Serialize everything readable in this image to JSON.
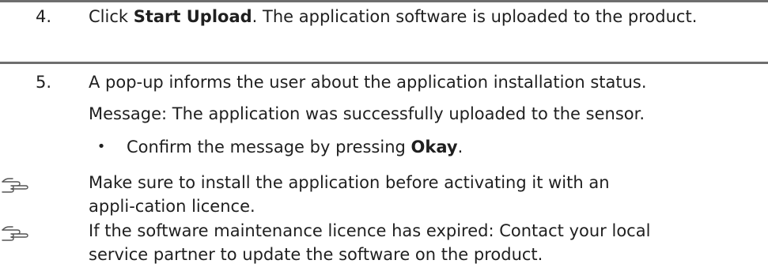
{
  "steps": [
    {
      "number": "4.",
      "text_before": "Click ",
      "bold": "Start Upload",
      "text_after": ". The application software is uploaded to the product."
    },
    {
      "number": "5.",
      "text": "A pop-up informs the user about the application installation status.",
      "message": "Message: The application was successfully uploaded to the sensor.",
      "bullet": {
        "symbol": "•",
        "text_before": "Confirm the message by pressing ",
        "bold": "Okay",
        "text_after": "."
      }
    }
  ],
  "notes": [
    {
      "icon": "pointing-hand-icon",
      "text": "Make sure to install the application before activating it with an appli-cation licence."
    },
    {
      "icon": "pointing-hand-icon",
      "text": "If the software maintenance licence has expired: Contact your local service partner to update the software on the product."
    }
  ]
}
